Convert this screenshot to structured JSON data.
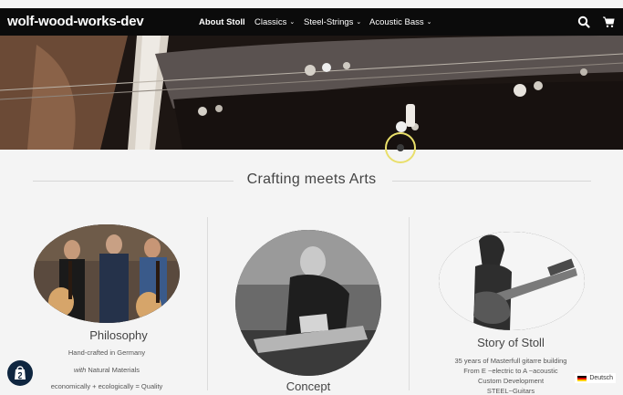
{
  "site": {
    "title": "wolf-wood-works-dev"
  },
  "nav": {
    "items": [
      {
        "label": "About Stoll",
        "active": true,
        "dropdown": false
      },
      {
        "label": "Classics",
        "active": false,
        "dropdown": true
      },
      {
        "label": "Steel-Strings",
        "active": false,
        "dropdown": true
      },
      {
        "label": "Acoustic Bass",
        "active": false,
        "dropdown": true
      }
    ],
    "icons": [
      "search-icon",
      "cart-icon"
    ]
  },
  "main": {
    "heading": "Crafting meets Arts",
    "cards": [
      {
        "title": "Philosophy",
        "lines": [
          "Hand-crafted in Germany",
          "Natural Materials",
          "economically + ecologically = Quality"
        ],
        "emphasis": "with"
      },
      {
        "title": "Concept",
        "lines": []
      },
      {
        "title": "Story of Stoll",
        "lines": [
          "35 years of Masterfull gitarre building",
          "From E ~electric to A ~acoustic",
          "Custom Development",
          "STEEL~Guitars"
        ]
      }
    ]
  },
  "footer": {
    "language": "Deutsch"
  },
  "colors": {
    "navbar": "#0b0b0b",
    "background": "#f4f4f4",
    "text": "#444444",
    "accent_ring": "#e9df6a"
  }
}
